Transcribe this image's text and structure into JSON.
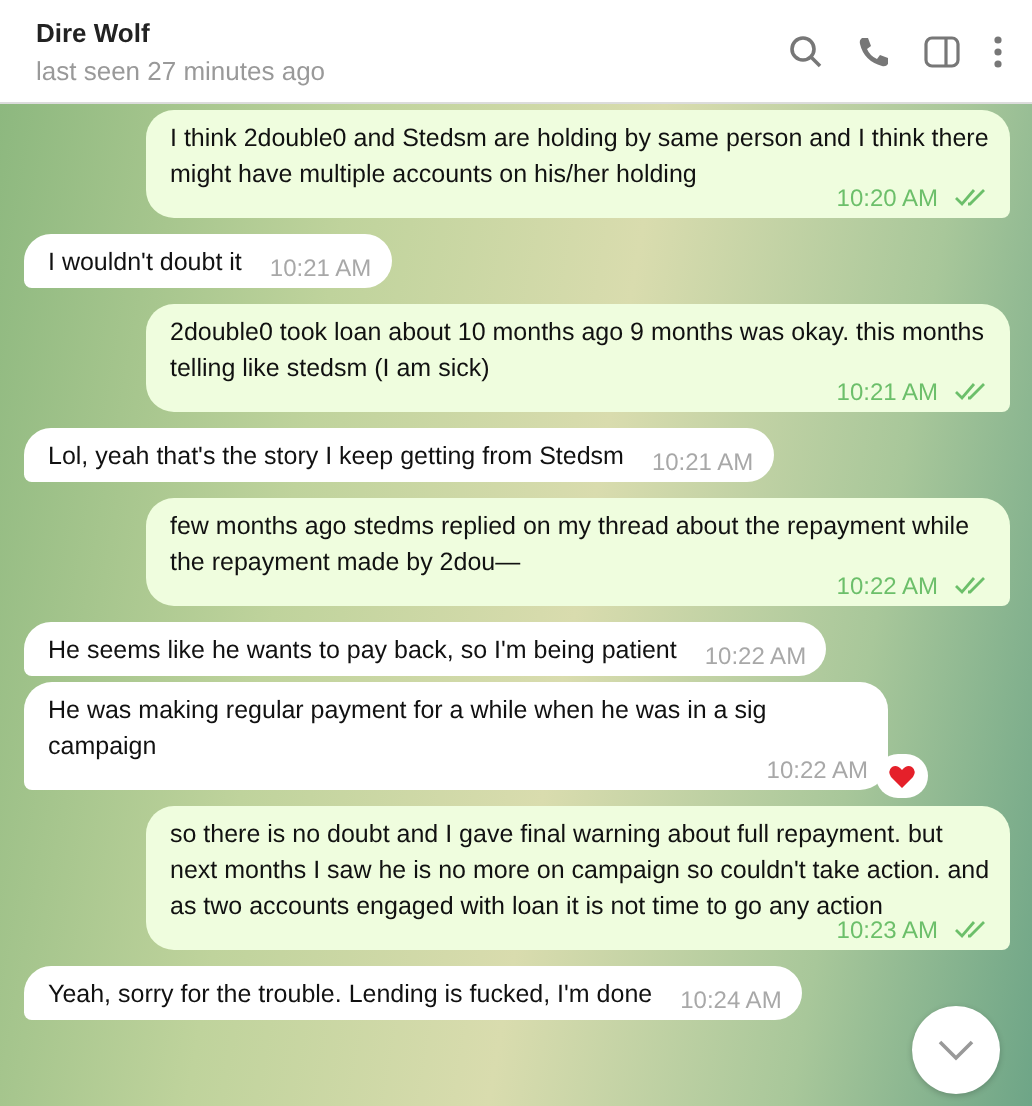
{
  "header": {
    "title": "Dire Wolf",
    "status": "last seen 27 minutes ago"
  },
  "messages": [
    {
      "kind": "outgoing",
      "text": "I think 2double0 and Stedsm are holding by same person and I think there might have multiple accounts on his/her holding",
      "time": "10:20 AM",
      "read": true,
      "reacted": false
    },
    {
      "kind": "incoming",
      "text": "I wouldn't doubt it",
      "time": "10:21 AM",
      "reacted": false
    },
    {
      "kind": "outgoing",
      "text": "2double0 took loan about 10 months ago 9 months was okay. this months telling like stedsm (I am sick)",
      "time": "10:21 AM",
      "read": true,
      "reacted": false
    },
    {
      "kind": "incoming",
      "text": "Lol, yeah that's the story I keep getting from Stedsm",
      "time": "10:21 AM",
      "reacted": false
    },
    {
      "kind": "outgoing",
      "text": "few months ago stedms replied on my thread about the repayment while the repayment made by 2dou—",
      "time": "10:22 AM",
      "read": true,
      "reacted": false
    },
    {
      "kind": "incoming",
      "text": "He seems like he wants to pay back, so I'm being patient",
      "time": "10:22 AM",
      "reacted": false
    },
    {
      "kind": "incoming",
      "text": "He was making regular payment for a while when he was in a sig campaign",
      "time": "10:22 AM",
      "reacted": true
    },
    {
      "kind": "outgoing",
      "text": "so there is no doubt and I gave final warning about full repayment. but next months I saw he is no more on campaign so couldn't take action. and as two accounts engaged with loan it is not time to go any action",
      "time": "10:23 AM",
      "read": true,
      "reacted": false
    },
    {
      "kind": "incoming",
      "text": "Yeah, sorry for the trouble.  Lending is fucked, I'm done",
      "time": "10:24 AM",
      "reacted": false
    }
  ]
}
